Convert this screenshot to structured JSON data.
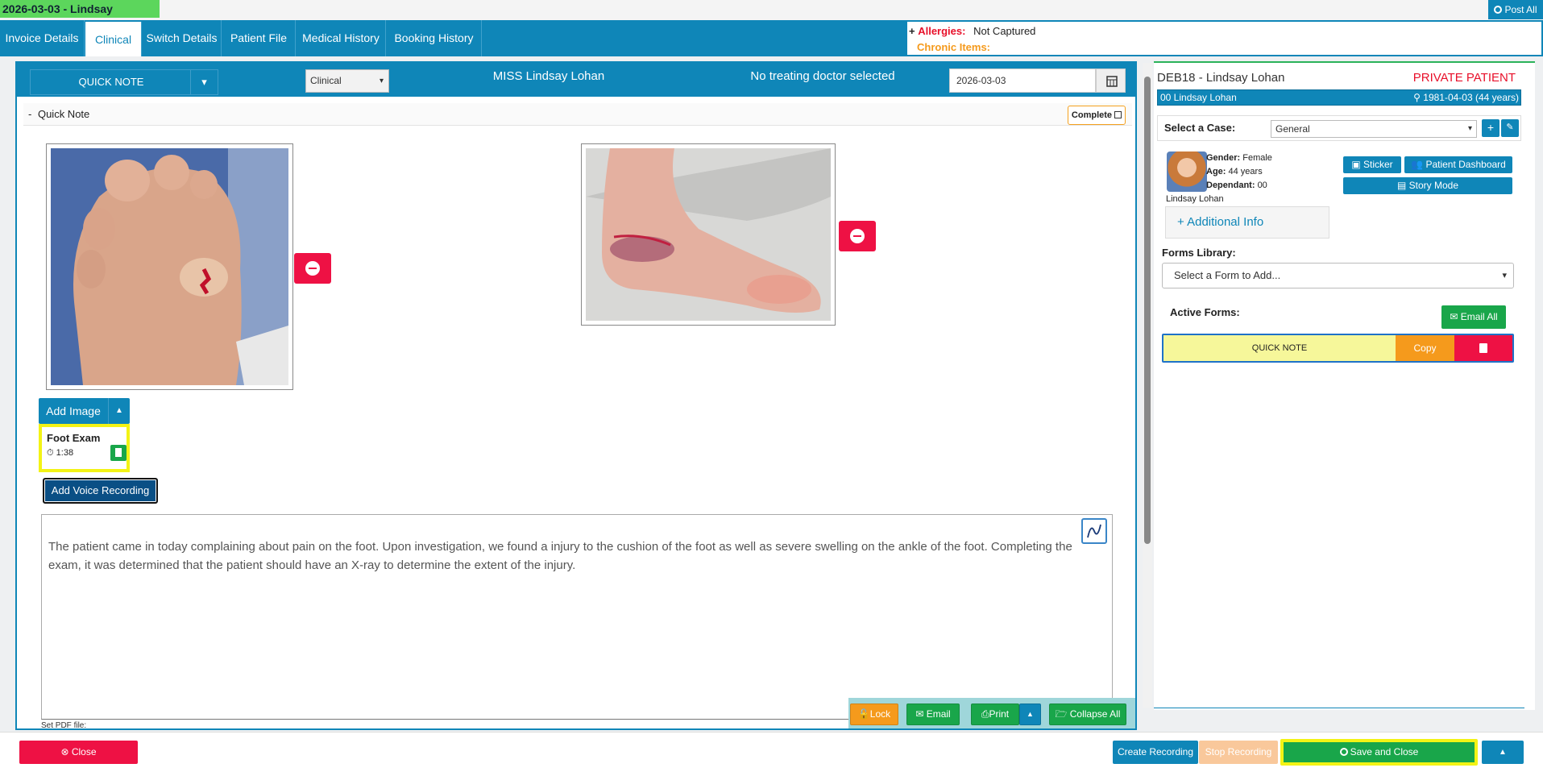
{
  "window": {
    "title": "2026-03-03 - Lindsay",
    "post_all": "Post All"
  },
  "tabs": [
    {
      "label": "Invoice Details"
    },
    {
      "label": "Clinical"
    },
    {
      "label": "Switch Details"
    },
    {
      "label": "Patient File"
    },
    {
      "label": "Medical History"
    },
    {
      "label": "Booking History"
    }
  ],
  "alerts": {
    "plus": "+",
    "allergies_label": "Allergies:",
    "allergies_value": "Not Captured",
    "chronic_label": "Chronic Items:"
  },
  "note_header": {
    "note_type": "QUICK NOTE",
    "category": "Clinical",
    "patient": "MISS Lindsay Lohan",
    "doctor": "No treating doctor selected",
    "date": "2026-03-03"
  },
  "section": {
    "collapse_symbol": "-",
    "title": "Quick Note",
    "complete_label": "Complete"
  },
  "images": {
    "add_label": "Add Image"
  },
  "recording": {
    "title": "Foot Exam",
    "duration": "1:38",
    "add_voice_label": "Add Voice Recording"
  },
  "note": {
    "text": "The patient came in today complaining about pain on the foot. Upon investigation, we found a injury to the cushion of the foot as well as severe swelling on the ankle of the foot. Completing the exam, it was determined that the patient should have an X-ray to determine the extent of the injury.",
    "pdf_label": "Set PDF file:"
  },
  "note_toolbar": {
    "lock": "Lock",
    "email": "Email",
    "print": "Print",
    "collapse_all": "Collapse All"
  },
  "patient_panel": {
    "account": "DEB18 - Lindsay Lohan",
    "status": "PRIVATE PATIENT",
    "member": "00 Lindsay Lohan",
    "dob": "1981-04-03 (44 years)",
    "case_label": "Select a Case:",
    "case_value": "General",
    "gender_label": "Gender:",
    "gender": "Female",
    "age_label": "Age:",
    "age": "44 years",
    "dependant_label": "Dependant:",
    "dependant": "00",
    "full_name": "Lindsay Lohan",
    "sticker": "Sticker",
    "dashboard": "Patient Dashboard",
    "story_mode": "Story Mode",
    "additional_info": "+ Additional Info",
    "forms_label": "Forms Library:",
    "forms_placeholder": "Select a Form to Add...",
    "active_forms_label": "Active Forms:",
    "email_all": "Email All",
    "active_form": {
      "name": "QUICK NOTE",
      "copy": "Copy"
    }
  },
  "bottom": {
    "close": "Close",
    "create_recording": "Create Recording",
    "stop_recording": "Stop Recording",
    "save_close": "Save and Close"
  },
  "colors": {
    "primary": "#0f86b8",
    "success": "#19a64a",
    "danger": "#ee1144",
    "warning": "#f59a1c",
    "highlight": "#f3f315"
  }
}
